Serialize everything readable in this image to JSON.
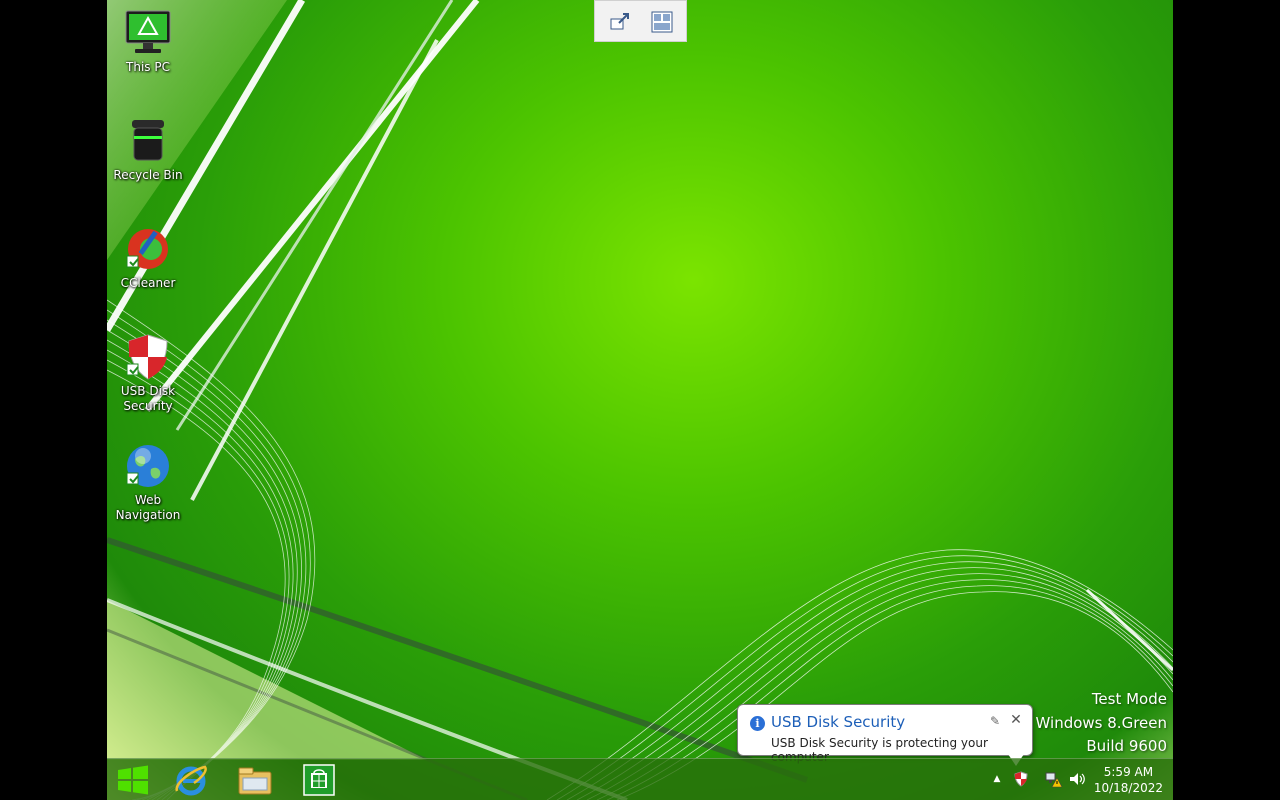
{
  "desktop_icons": [
    {
      "label": "This PC",
      "icon": "monitor-icon"
    },
    {
      "label": "Recycle Bin",
      "icon": "recycle-bin-icon"
    },
    {
      "label": "CCleaner",
      "icon": "ccleaner-icon"
    },
    {
      "label_line1": "USB Disk",
      "label_line2": "Security",
      "icon": "shield-icon"
    },
    {
      "label_line1": "Web",
      "label_line2": "Navigation",
      "icon": "globe-icon"
    }
  ],
  "watermark": {
    "line1": "Test Mode",
    "line2": "Windows 8.Green",
    "line3": "Build 9600"
  },
  "notification": {
    "title": "USB Disk Security",
    "message": "USB Disk Security is protecting your computer",
    "icon": "info-icon"
  },
  "taskbar": {
    "apps": [
      "start-icon",
      "internet-explorer-icon",
      "file-explorer-icon",
      "store-icon"
    ],
    "clock_time": "5:59 AM",
    "clock_date": "10/18/2022"
  },
  "colors": {
    "wallpaper_green": "#4cc400",
    "toast_title": "#1d5fb8"
  }
}
